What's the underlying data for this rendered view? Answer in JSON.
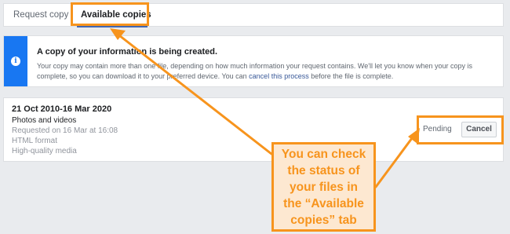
{
  "tabs": {
    "request": "Request copy",
    "available": "Available copies"
  },
  "info": {
    "icon": "info-icon",
    "title": "A copy of your information is being created.",
    "body_prefix": "Your copy may contain more than one file, depending on how much information your request contains. We'll let you know when your copy is complete, so you can download it to your preferred device. You can ",
    "link": "cancel this process",
    "body_suffix": " before the file is complete."
  },
  "copy": {
    "date_range": "21 Oct 2010-16 Mar 2020",
    "type": "Photos and videos",
    "requested": "Requested on 16 Mar at 16:08",
    "format": "HTML format",
    "quality": "High-quality media",
    "status": "Pending",
    "cancel_label": "Cancel"
  },
  "callout": {
    "text": "You can check\nthe status of\nyour files in\nthe “Available\ncopies” tab"
  },
  "colors": {
    "highlight": "#f7941d",
    "callout_fill": "#fde8d1",
    "info_blue": "#1877f2",
    "tab_underline": "#4267b2"
  }
}
